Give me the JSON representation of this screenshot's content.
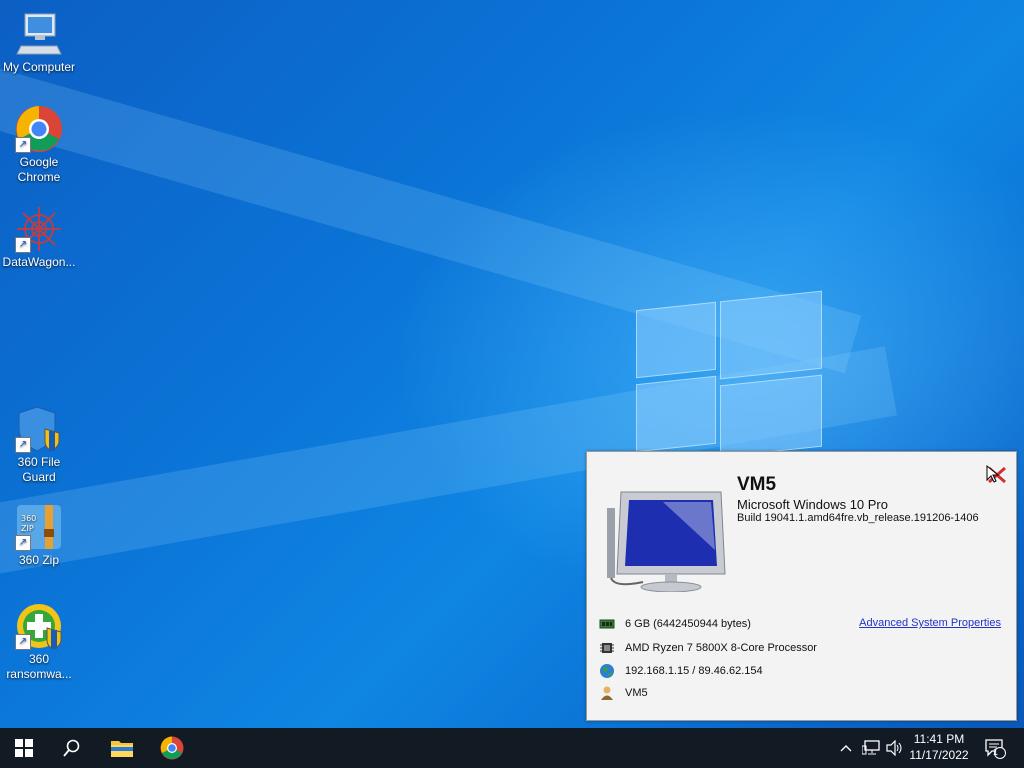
{
  "desktop": {
    "icons": [
      {
        "label": "My Computer",
        "icon": "computer-icon"
      },
      {
        "label": "Google Chrome",
        "icon": "chrome-icon"
      },
      {
        "label": "DataWagon...",
        "icon": "datawagon-icon"
      },
      {
        "label": "360 File Guard",
        "icon": "shield-folder-icon"
      },
      {
        "label": "360 Zip",
        "icon": "zip-archive-icon"
      },
      {
        "label": "360 ransomwa...",
        "icon": "ransomware-shield-icon"
      }
    ]
  },
  "sysinfo": {
    "hostname": "VM5",
    "os": "Microsoft Windows 10 Pro",
    "build": "Build 19041.1.amd64fre.vb_release.191206-1406",
    "memory": "6 GB (6442450944 bytes)",
    "cpu": "AMD Ryzen 7 5800X 8-Core Processor",
    "network": "192.168.1.15 / 89.46.62.154",
    "user": "VM5",
    "advanced_link": "Advanced System Properties"
  },
  "taskbar": {
    "time": "11:41 PM",
    "date": "11/17/2022",
    "notification_count": "1"
  },
  "colors": {
    "taskbar": "#121a24",
    "desktop_accent": "#0b73d6",
    "link": "#2232c8"
  }
}
